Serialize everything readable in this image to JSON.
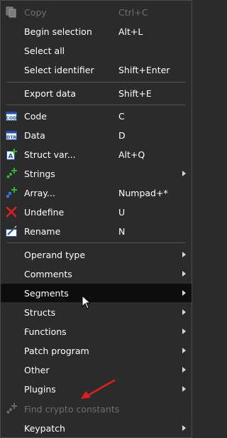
{
  "menu": {
    "copy": {
      "label": "Copy",
      "shortcut": "Ctrl+C",
      "icon": "copy-icon"
    },
    "begin_selection": {
      "label": "Begin selection",
      "shortcut": "Alt+L"
    },
    "select_all": {
      "label": "Select all"
    },
    "select_identifier": {
      "label": "Select identifier",
      "shortcut": "Shift+Enter"
    },
    "export_data": {
      "label": "Export data",
      "shortcut": "Shift+E"
    },
    "code": {
      "label": "Code",
      "shortcut": "C",
      "icon": "code-icon"
    },
    "data": {
      "label": "Data",
      "shortcut": "D",
      "icon": "data-icon"
    },
    "struct_var": {
      "label": "Struct var...",
      "shortcut": "Alt+Q",
      "icon": "struct-icon"
    },
    "strings": {
      "label": "Strings",
      "icon": "strings-icon"
    },
    "array": {
      "label": "Array...",
      "shortcut": "Numpad+*",
      "icon": "array-icon"
    },
    "undefine": {
      "label": "Undefine",
      "shortcut": "U",
      "icon": "undefine-icon"
    },
    "rename": {
      "label": "Rename",
      "shortcut": "N",
      "icon": "rename-icon"
    },
    "operand_type": {
      "label": "Operand type"
    },
    "comments": {
      "label": "Comments"
    },
    "segments": {
      "label": "Segments"
    },
    "structs": {
      "label": "Structs"
    },
    "functions": {
      "label": "Functions"
    },
    "patch_program": {
      "label": "Patch program"
    },
    "other": {
      "label": "Other"
    },
    "plugins": {
      "label": "Plugins"
    },
    "find_crypto": {
      "label": "Find crypto constants",
      "icon": "plugin-icon"
    },
    "keypatch": {
      "label": "Keypatch"
    }
  },
  "colors": {
    "background": "#2b2b2b",
    "highlight": "#0d0d0d",
    "text": "#ffffff",
    "disabled_text": "#6e6e6e",
    "annotation_arrow": "#e02020"
  }
}
